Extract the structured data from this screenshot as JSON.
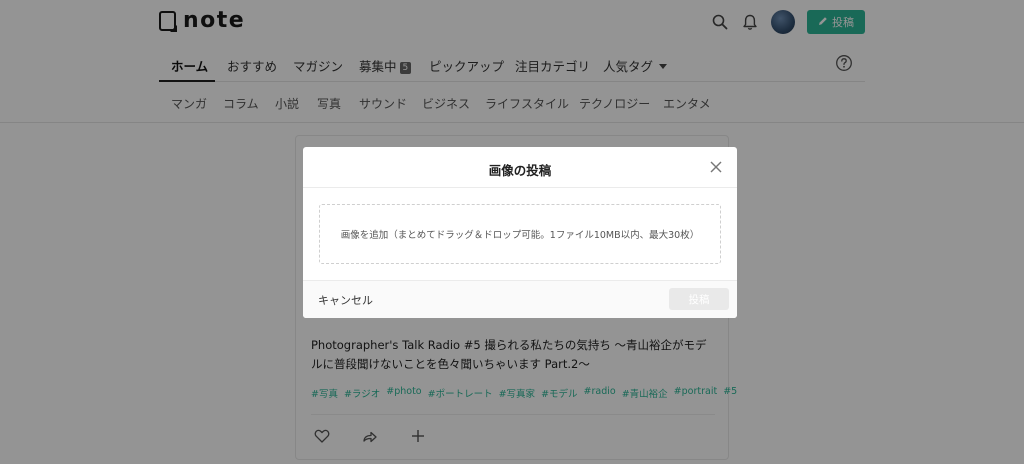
{
  "header": {
    "logo_text": "note",
    "post_label": "投稿",
    "icons": [
      "search-icon",
      "bell-icon",
      "avatar",
      "pencil-icon"
    ]
  },
  "tabs": [
    {
      "label": "ホーム",
      "active": true
    },
    {
      "label": "おすすめ"
    },
    {
      "label": "マガジン"
    },
    {
      "label": "募集中",
      "badge": "5"
    },
    {
      "label": "ピックアップ"
    },
    {
      "label": "注目カテゴリ"
    },
    {
      "label": "人気タグ",
      "dropdown": true
    }
  ],
  "categories": [
    "マンガ",
    "コラム",
    "小説",
    "写真",
    "サウンド",
    "ビジネス",
    "ライフスタイル",
    "テクノロジー",
    "エンタメ"
  ],
  "card": {
    "title": "Photographer's Talk Radio #5 撮られる私たちの気持ち 〜青山裕企がモデルに普段聞けないことを色々聞いちゃいます Part.2〜",
    "tags": [
      "#写真",
      "#ラジオ",
      "#photo",
      "#ポートレート",
      "#写真家",
      "#モデル",
      "#radio",
      "#青山裕企",
      "#portrait",
      "#5"
    ],
    "actions": [
      "heart-icon",
      "share-icon",
      "plus-icon"
    ]
  },
  "modal": {
    "title": "画像の投稿",
    "dropzone_text": "画像を追加（まとめてドラッグ＆ドロップ可能。1ファイル10MB以内、最大30枚）",
    "cancel_label": "キャンセル",
    "submit_label": "投稿"
  },
  "colors": {
    "accent": "#2cb696",
    "overlay": "rgba(0,0,0,0.42)",
    "disabled_button": "#e9e9e9"
  }
}
